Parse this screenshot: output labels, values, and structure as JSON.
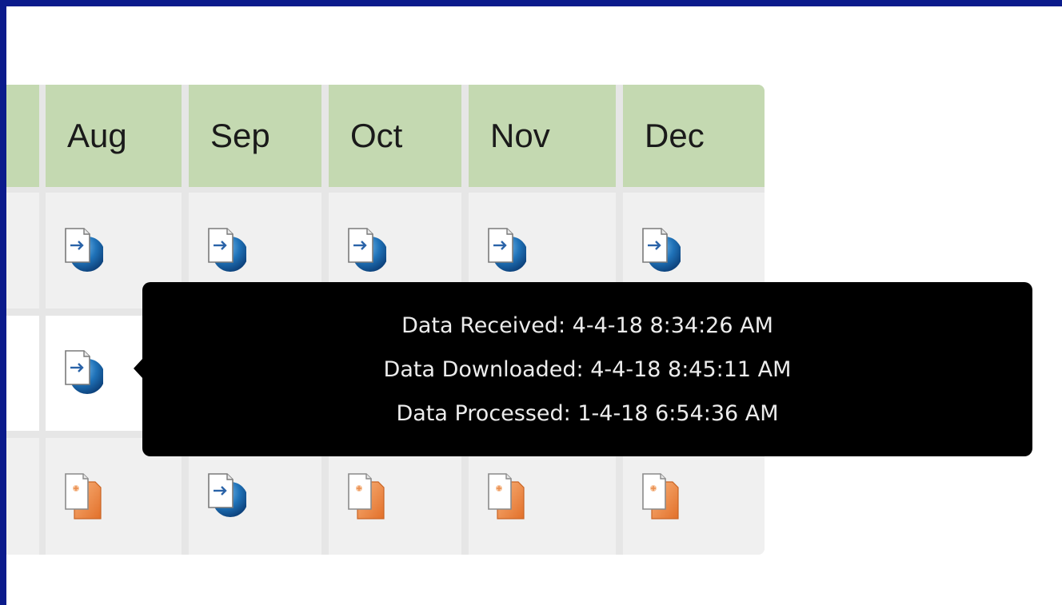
{
  "table": {
    "months": [
      "Aug",
      "Sep",
      "Oct",
      "Nov",
      "Dec"
    ],
    "rows": [
      {
        "status": [
          "download-icon",
          "download-icon",
          "download-icon",
          "download-icon",
          "download-icon"
        ]
      },
      {
        "status": [
          "download-icon",
          "download-icon",
          "download-icon",
          "download-icon",
          "download-icon"
        ]
      },
      {
        "status": [
          "pending-file-icon",
          "download-icon",
          "pending-file-icon",
          "pending-file-icon",
          "pending-file-icon"
        ]
      }
    ]
  },
  "tooltip": {
    "lines": [
      "Data Received: 4-4-18 8:34:26 AM",
      "Data Downloaded: 4-4-18 8:45:11 AM",
      "Data Processed: 1-4-18 6:54:36 AM"
    ]
  },
  "colors": {
    "frame": "#0b1b8c",
    "header_bg": "#c4d9b1",
    "cell_bg": "#f0f0f0",
    "download_icon": "#1f72b8",
    "pending_icon": "#f08a3e",
    "tooltip_bg": "#000000"
  }
}
